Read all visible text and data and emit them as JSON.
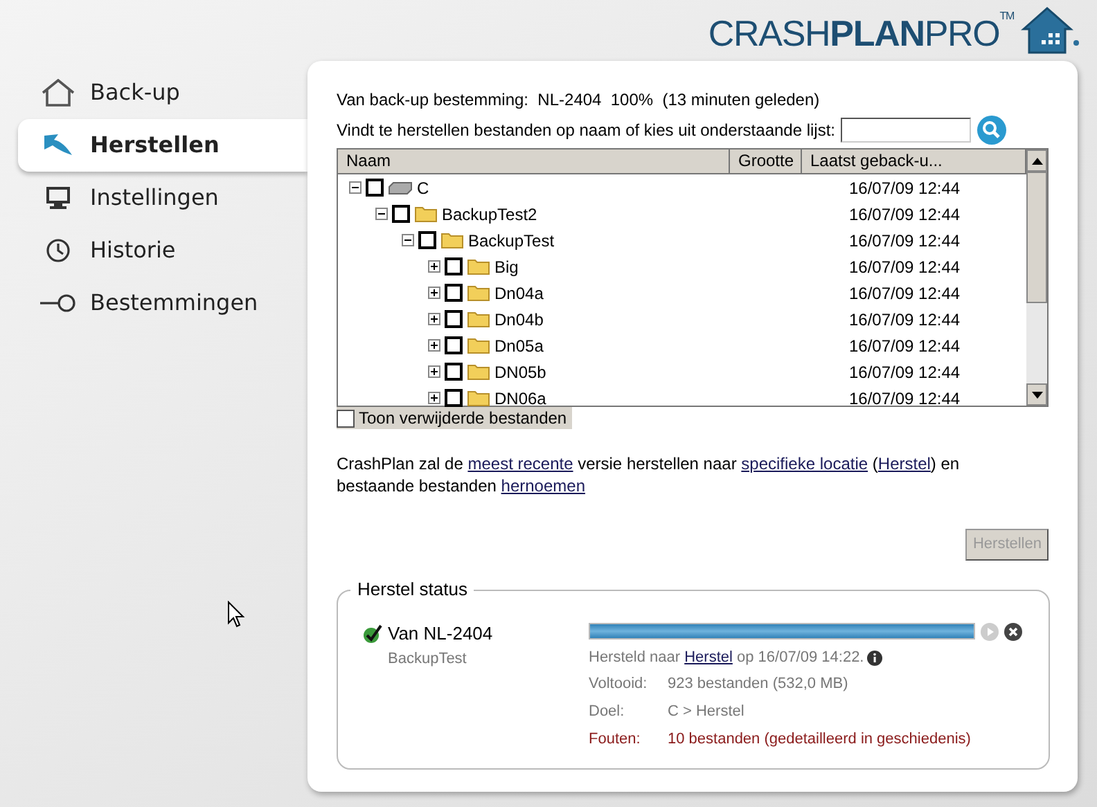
{
  "logo": "CRASH**PLAN**PRO$^{TM}$",
  "sidebar": {
    "items": [
      {
        "label": "Back-up",
        "kind": "home",
        "selected": false
      },
      {
        "label": "Herstellen",
        "kind": "restore",
        "selected": true
      },
      {
        "label": "Instellingen",
        "kind": "monitor",
        "selected": false
      },
      {
        "label": "Historie",
        "kind": "clock",
        "selected": false
      },
      {
        "label": "Bestemmingen",
        "kind": "target",
        "selected": false
      }
    ]
  },
  "destination_line": "Van back-up bestemming:  NL-2404  100%  (13 minuten geleden)",
  "search": {
    "label": "Vindt te herstellen bestanden op naam of kies uit onderstaande lijst:"
  },
  "tree": {
    "columns": [
      "Naam",
      "Grootte",
      "Laatst geback-u..."
    ],
    "rows": [
      {
        "name": "C",
        "kind": "drive",
        "checked": false,
        "expanded": true,
        "date": "16/07/09 12:44",
        "children": [
          {
            "name": "BackupTest2",
            "kind": "folder",
            "checked": false,
            "expanded": true,
            "date": "16/07/09 12:44",
            "children": [
              {
                "name": "BackupTest",
                "kind": "folder",
                "checked": false,
                "expanded": true,
                "date": "16/07/09 12:44",
                "children": [
                  {
                    "name": "Big",
                    "kind": "folder",
                    "checked": false,
                    "expanded": false,
                    "date": "16/07/09 12:44"
                  },
                  {
                    "name": "Dn04a",
                    "kind": "folder",
                    "checked": false,
                    "expanded": false,
                    "date": "16/07/09 12:44"
                  },
                  {
                    "name": "Dn04b",
                    "kind": "folder",
                    "checked": false,
                    "expanded": false,
                    "date": "16/07/09 12:44"
                  },
                  {
                    "name": "Dn05a",
                    "kind": "folder",
                    "checked": false,
                    "expanded": false,
                    "date": "16/07/09 12:44"
                  },
                  {
                    "name": "DN05b",
                    "kind": "folder",
                    "checked": false,
                    "expanded": false,
                    "date": "16/07/09 12:44"
                  },
                  {
                    "name": "DN06a",
                    "kind": "folder",
                    "checked": false,
                    "expanded": false,
                    "date": "16/07/09 12:44"
                  }
                ]
              }
            ]
          }
        ]
      }
    ]
  },
  "show_deleted": {
    "label": "Toon verwijderde bestanden",
    "checked": false
  },
  "description": [
    {
      "text": "CrashPlan zal de ",
      "link": false
    },
    {
      "text": "meest recente",
      "link": true
    },
    {
      "text": " versie herstellen naar ",
      "link": false
    },
    {
      "text": "specifieke locatie",
      "link": true
    },
    {
      "text": " (",
      "link": false
    },
    {
      "text": "Herstel",
      "link": true
    },
    {
      "text": ") en bestaande bestanden ",
      "link": false
    },
    {
      "text": "hernoemen",
      "link": true
    }
  ],
  "restore_button": {
    "label": "Herstellen",
    "disabled": true
  },
  "restore_status": {
    "title": "Herstel status",
    "item": {
      "done": true,
      "name": "Van NL-2404",
      "subtitle": "BackupTest",
      "level": 1.0,
      "info": [
        {
          "text": "Hersteld naar ",
          "link": false
        },
        {
          "text": "Herstel",
          "link": true
        },
        {
          "text": " op 16/07/09 14:22.",
          "link": false
        }
      ],
      "details": [
        {
          "label": "Voltooid:",
          "value": "923 bestanden (532,0 MB)",
          "kind": "normal"
        },
        {
          "label": "Doel:",
          "value": "C > Herstel",
          "kind": "normal"
        },
        {
          "label": "Fouten:",
          "value": "10 bestanden (gedetailleerd in geschiedenis)",
          "kind": "error"
        }
      ]
    }
  }
}
